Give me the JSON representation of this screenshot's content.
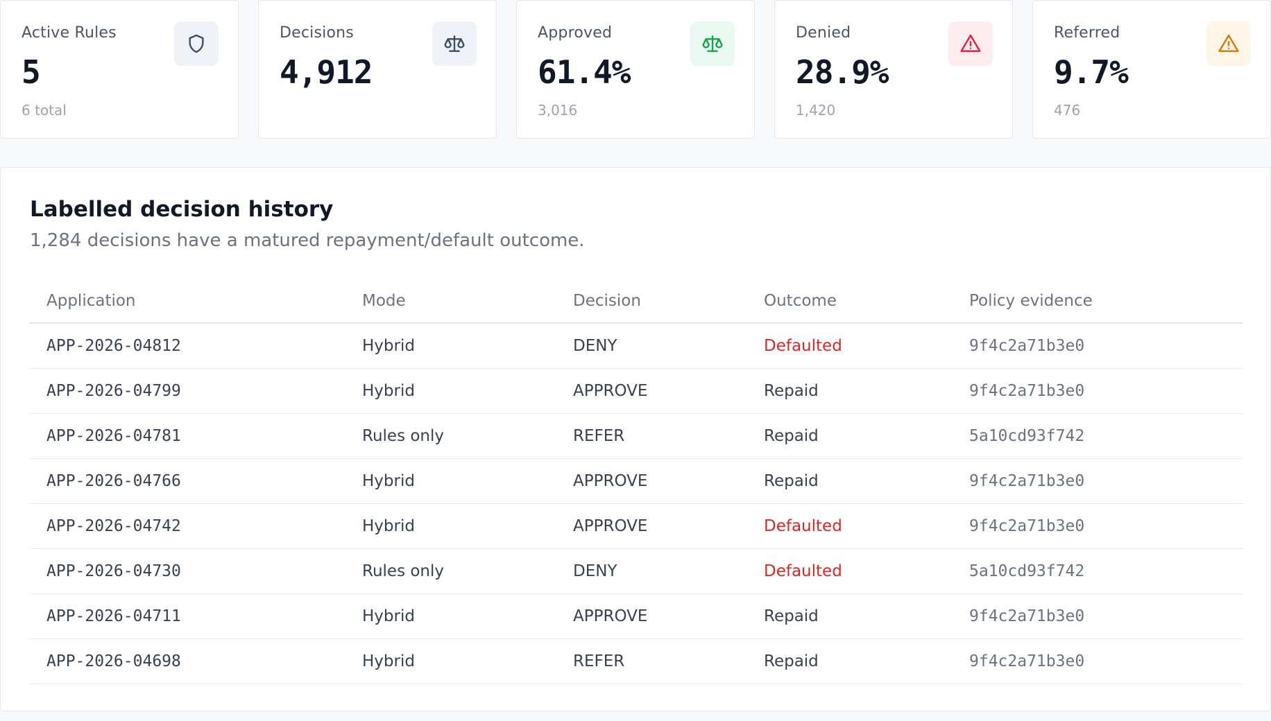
{
  "stats": [
    {
      "label": "Active Rules",
      "value": "5",
      "sub": "6 total",
      "icon": "shield-icon",
      "bg": "#eef1f6",
      "fg": "#3b4d6b"
    },
    {
      "label": "Decisions",
      "value": "4,912",
      "sub": "",
      "icon": "scale-icon",
      "bg": "#eef1f6",
      "fg": "#3b4d6b"
    },
    {
      "label": "Approved",
      "value": "61.4%",
      "sub": "3,016",
      "icon": "scale-icon",
      "bg": "#e9f8f0",
      "fg": "#16a34a"
    },
    {
      "label": "Denied",
      "value": "28.9%",
      "sub": "1,420",
      "icon": "alert-triangle-icon",
      "bg": "#fdecee",
      "fg": "#e11d48"
    },
    {
      "label": "Referred",
      "value": "9.7%",
      "sub": "476",
      "icon": "alert-triangle-icon",
      "bg": "#fdf6e7",
      "fg": "#d97706"
    }
  ],
  "history": {
    "title": "Labelled decision history",
    "subtitle": "1,284 decisions have a matured repayment/default outcome.",
    "columns": [
      "Application",
      "Mode",
      "Decision",
      "Outcome",
      "Policy evidence"
    ],
    "rows": [
      {
        "application": "APP-2026-04812",
        "mode": "Hybrid",
        "decision": "DENY",
        "outcome": "Defaulted",
        "evidence": "9f4c2a71b3e0"
      },
      {
        "application": "APP-2026-04799",
        "mode": "Hybrid",
        "decision": "APPROVE",
        "outcome": "Repaid",
        "evidence": "9f4c2a71b3e0"
      },
      {
        "application": "APP-2026-04781",
        "mode": "Rules only",
        "decision": "REFER",
        "outcome": "Repaid",
        "evidence": "5a10cd93f742"
      },
      {
        "application": "APP-2026-04766",
        "mode": "Hybrid",
        "decision": "APPROVE",
        "outcome": "Repaid",
        "evidence": "9f4c2a71b3e0"
      },
      {
        "application": "APP-2026-04742",
        "mode": "Hybrid",
        "decision": "APPROVE",
        "outcome": "Defaulted",
        "evidence": "9f4c2a71b3e0"
      },
      {
        "application": "APP-2026-04730",
        "mode": "Rules only",
        "decision": "DENY",
        "outcome": "Defaulted",
        "evidence": "5a10cd93f742"
      },
      {
        "application": "APP-2026-04711",
        "mode": "Hybrid",
        "decision": "APPROVE",
        "outcome": "Repaid",
        "evidence": "9f4c2a71b3e0"
      },
      {
        "application": "APP-2026-04698",
        "mode": "Hybrid",
        "decision": "REFER",
        "outcome": "Repaid",
        "evidence": "9f4c2a71b3e0"
      }
    ]
  },
  "colors": {
    "defaulted": "#dc2626",
    "repaid": "#374151"
  }
}
